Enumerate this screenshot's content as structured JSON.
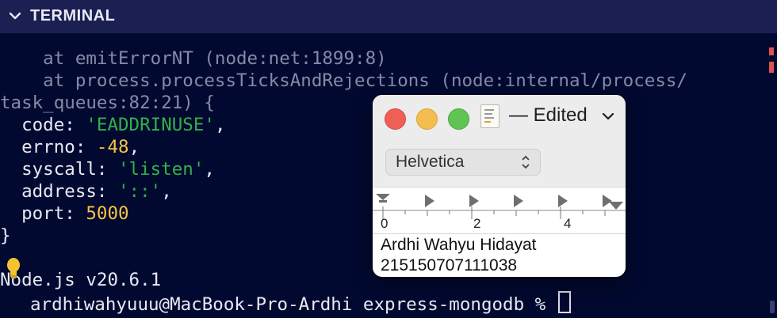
{
  "panel": {
    "title": "TERMINAL"
  },
  "terminal": {
    "line1": "    at emitErrorNT (node:net:1899:8)",
    "line2": "    at process.processTicksAndRejections (node:internal/process/",
    "line3": "task_queues:82:21) {",
    "code_key": "  code: ",
    "code_val": "'EADDRINUSE'",
    "errno_key": "  errno: ",
    "errno_val": "-48",
    "syscall_key": "  syscall: ",
    "syscall_val": "'listen'",
    "address_key": "  address: ",
    "address_val": "'::'",
    "port_key": "  port: ",
    "port_val": "5000",
    "close_brace": "}",
    "node_version": "Node.js v20.6.1",
    "prompt": "ardhiwahyuuu@MacBook-Pro-Ardhi express-mongodb % "
  },
  "textedit": {
    "title": "— Edited",
    "font": "Helvetica",
    "ruler_labels": [
      "0",
      "2",
      "4"
    ],
    "lines": [
      "Ardhi Wahyu Hidayat",
      "215150707111038"
    ]
  },
  "colors": {
    "terminal_bg": "#020930",
    "string": "#32b14a",
    "number": "#f5c542",
    "panel_header": "#1b1f52"
  },
  "icons": [
    "chevron-down-icon",
    "lightbulb-icon",
    "document-icon",
    "chevron-down-icon",
    "up-down-arrows-icon"
  ]
}
